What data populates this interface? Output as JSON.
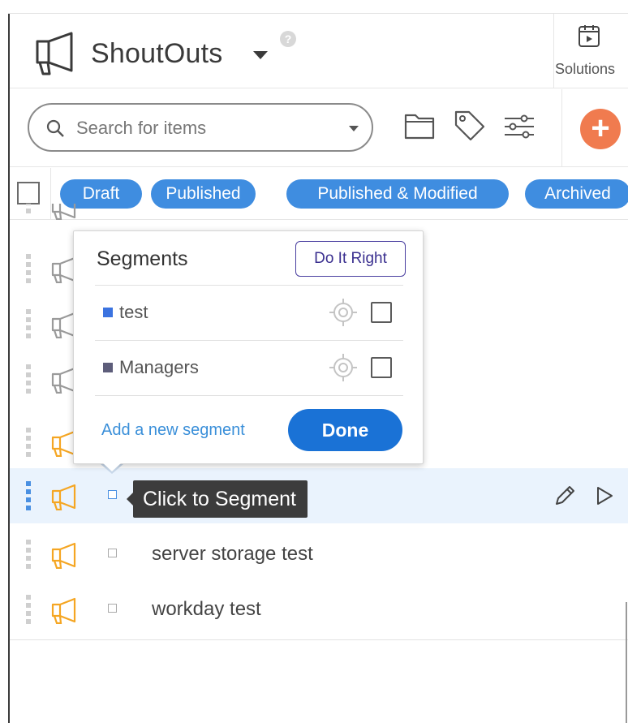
{
  "header": {
    "title": "ShoutOuts",
    "help": "?",
    "solutions_label": "Solutions"
  },
  "toolbar": {
    "search_placeholder": "Search for items",
    "add_label": "+"
  },
  "filters": {
    "chips": [
      "Draft",
      "Published",
      "Published & Modified",
      "Archived"
    ]
  },
  "list": {
    "rows": [
      {
        "title": "",
        "icon_color": "#9a9a9a"
      },
      {
        "title": "",
        "icon_color": "#9a9a9a"
      },
      {
        "title": "",
        "icon_color": "#9a9a9a"
      },
      {
        "title": "",
        "icon_color": "#f5a623"
      },
      {
        "title": "",
        "icon_color": "#f5a623"
      },
      {
        "title": "server storage test",
        "icon_color": "#f5a623"
      },
      {
        "title": "workday test",
        "icon_color": "#f5a623"
      }
    ]
  },
  "tooltip": {
    "text": "Click to Segment"
  },
  "segments_popup": {
    "title": "Segments",
    "do_it_right_label": "Do It Right",
    "segments": [
      {
        "label": "test",
        "color": "#3b73e0"
      },
      {
        "label": "Managers",
        "color": "#5d5d7a"
      }
    ],
    "add_segment_label": "Add a new segment",
    "done_label": "Done"
  },
  "colors": {
    "chip_blue": "#3f8de0",
    "accent_orange": "#f07b4f",
    "done_blue": "#1a72d6",
    "megaphone_orange": "#f5a623"
  }
}
